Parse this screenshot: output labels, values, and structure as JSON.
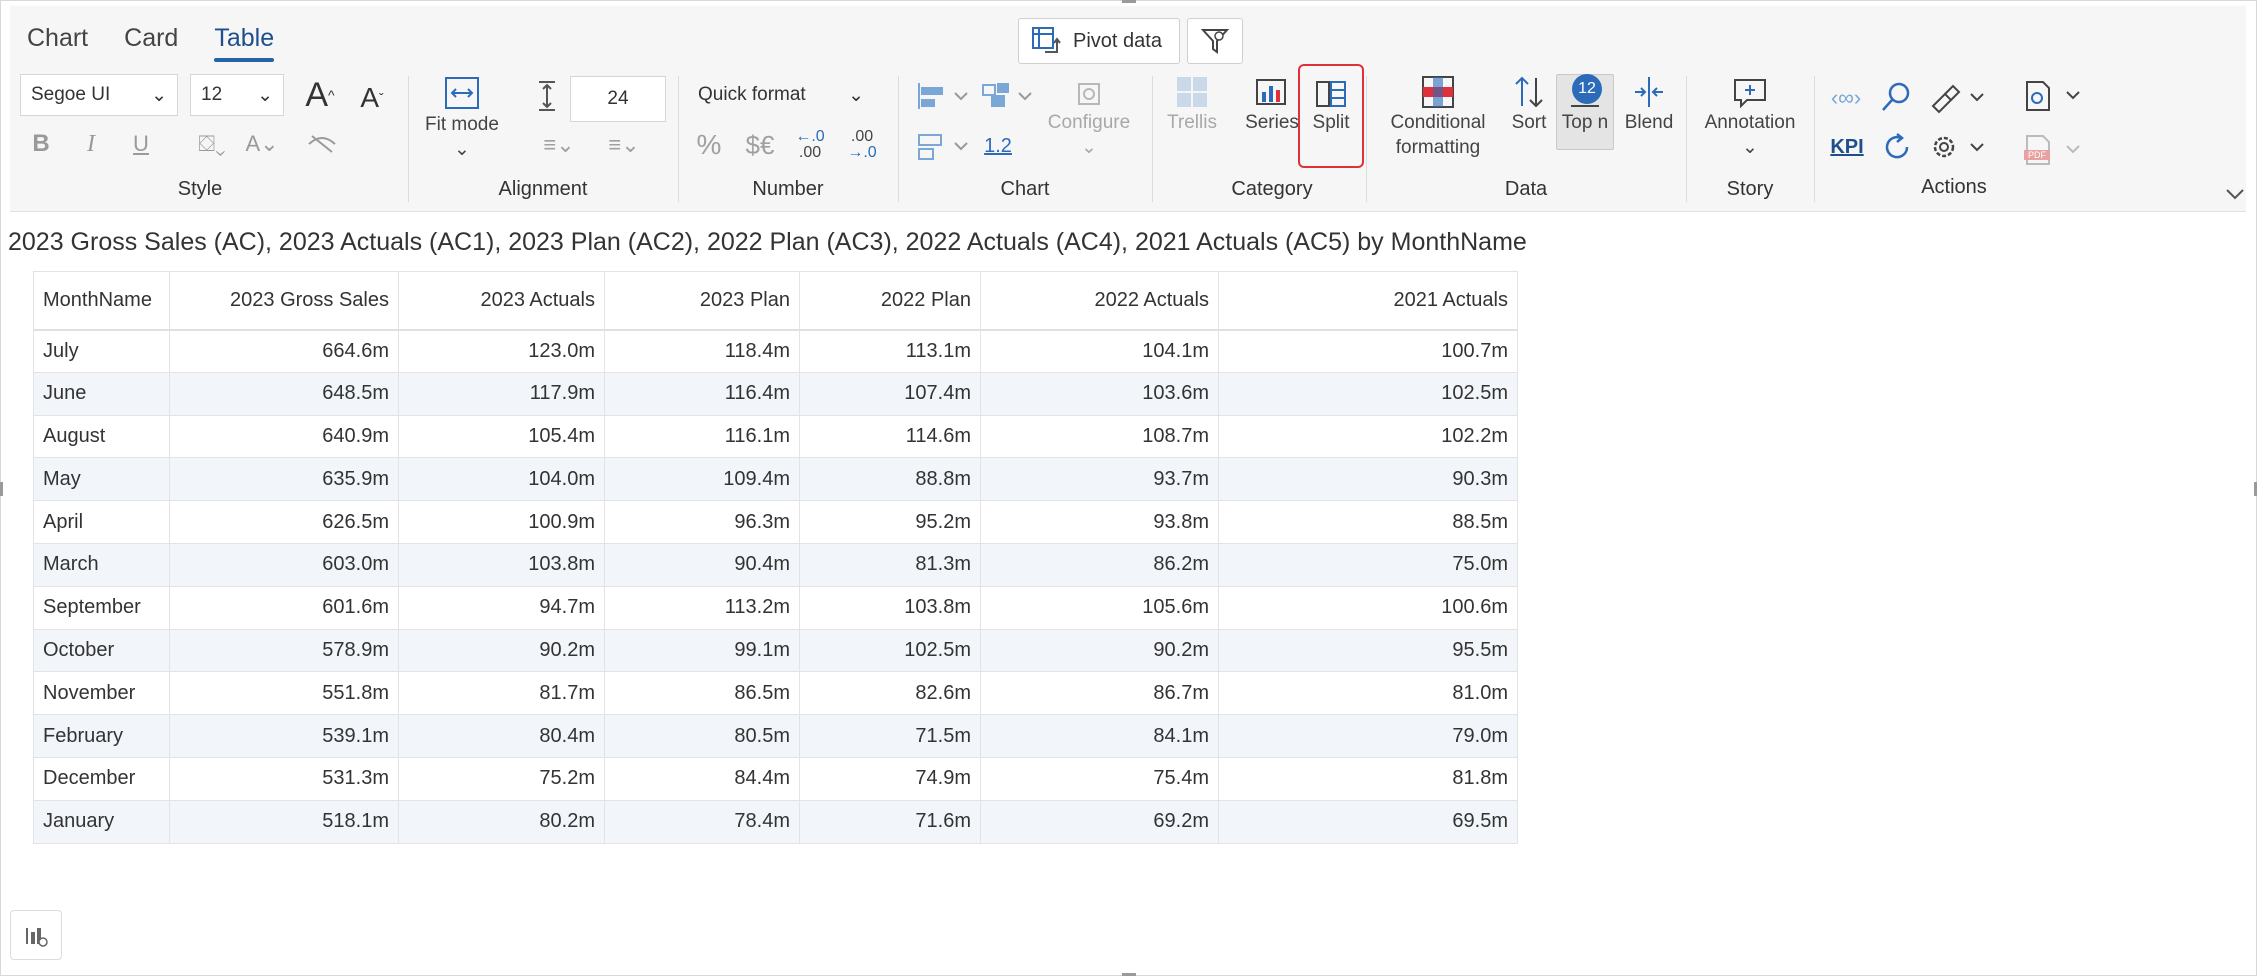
{
  "tabs": [
    {
      "label": "Chart",
      "active": false
    },
    {
      "label": "Card",
      "active": false
    },
    {
      "label": "Table",
      "active": true
    }
  ],
  "toolbar": {
    "pivot_label": "Pivot data",
    "font_family": "Segoe UI",
    "font_size": "12",
    "row_height": "24",
    "quick_format": "Quick format",
    "fit_mode": "Fit mode",
    "configure": "Configure",
    "trellis": "Trellis",
    "series": "Series",
    "split": "Split",
    "conditional_formatting": "Conditional formatting",
    "sort": "Sort",
    "top_n": "Top n",
    "top_n_badge": "12",
    "blend": "Blend",
    "annotation": "Annotation",
    "kpi": "KPI",
    "decimal_value": "1.2",
    "percent_glyph": "%",
    "currency_glyph": "$€",
    "dec_dec_glyph": ".00",
    "inc_dec_glyph": ".00",
    "bold": "B",
    "italic": "I",
    "underline": "U",
    "grow_font": "A",
    "shrink_font": "A",
    "pdf_label": "PDF"
  },
  "groups": {
    "style": "Style",
    "alignment": "Alignment",
    "number": "Number",
    "chart": "Chart",
    "category": "Category",
    "data": "Data",
    "story": "Story",
    "actions": "Actions"
  },
  "title": "2023 Gross Sales (AC), 2023 Actuals (AC1), 2023 Plan (AC2), 2022 Plan (AC3), 2022 Actuals (AC4), 2021 Actuals (AC5) by MonthName",
  "table": {
    "headers": [
      "MonthName",
      "2023 Gross Sales",
      "2023 Actuals",
      "2023 Plan",
      "2022 Plan",
      "2022 Actuals",
      "2021 Actuals"
    ],
    "rows": [
      [
        "July",
        "664.6m",
        "123.0m",
        "118.4m",
        "113.1m",
        "104.1m",
        "100.7m"
      ],
      [
        "June",
        "648.5m",
        "117.9m",
        "116.4m",
        "107.4m",
        "103.6m",
        "102.5m"
      ],
      [
        "August",
        "640.9m",
        "105.4m",
        "116.1m",
        "114.6m",
        "108.7m",
        "102.2m"
      ],
      [
        "May",
        "635.9m",
        "104.0m",
        "109.4m",
        "88.8m",
        "93.7m",
        "90.3m"
      ],
      [
        "April",
        "626.5m",
        "100.9m",
        "96.3m",
        "95.2m",
        "93.8m",
        "88.5m"
      ],
      [
        "March",
        "603.0m",
        "103.8m",
        "90.4m",
        "81.3m",
        "86.2m",
        "75.0m"
      ],
      [
        "September",
        "601.6m",
        "94.7m",
        "113.2m",
        "103.8m",
        "105.6m",
        "100.6m"
      ],
      [
        "October",
        "578.9m",
        "90.2m",
        "99.1m",
        "102.5m",
        "90.2m",
        "95.5m"
      ],
      [
        "November",
        "551.8m",
        "81.7m",
        "86.5m",
        "82.6m",
        "86.7m",
        "81.0m"
      ],
      [
        "February",
        "539.1m",
        "80.4m",
        "80.5m",
        "71.5m",
        "84.1m",
        "79.0m"
      ],
      [
        "December",
        "531.3m",
        "75.2m",
        "84.4m",
        "74.9m",
        "75.4m",
        "81.8m"
      ],
      [
        "January",
        "518.1m",
        "80.2m",
        "78.4m",
        "71.6m",
        "69.2m",
        "69.5m"
      ]
    ]
  },
  "colors": {
    "accent": "#2563a8",
    "highlight": "#e0313b",
    "stripe": "#f2f6fa",
    "icon_blue": "#2c6bb9"
  }
}
